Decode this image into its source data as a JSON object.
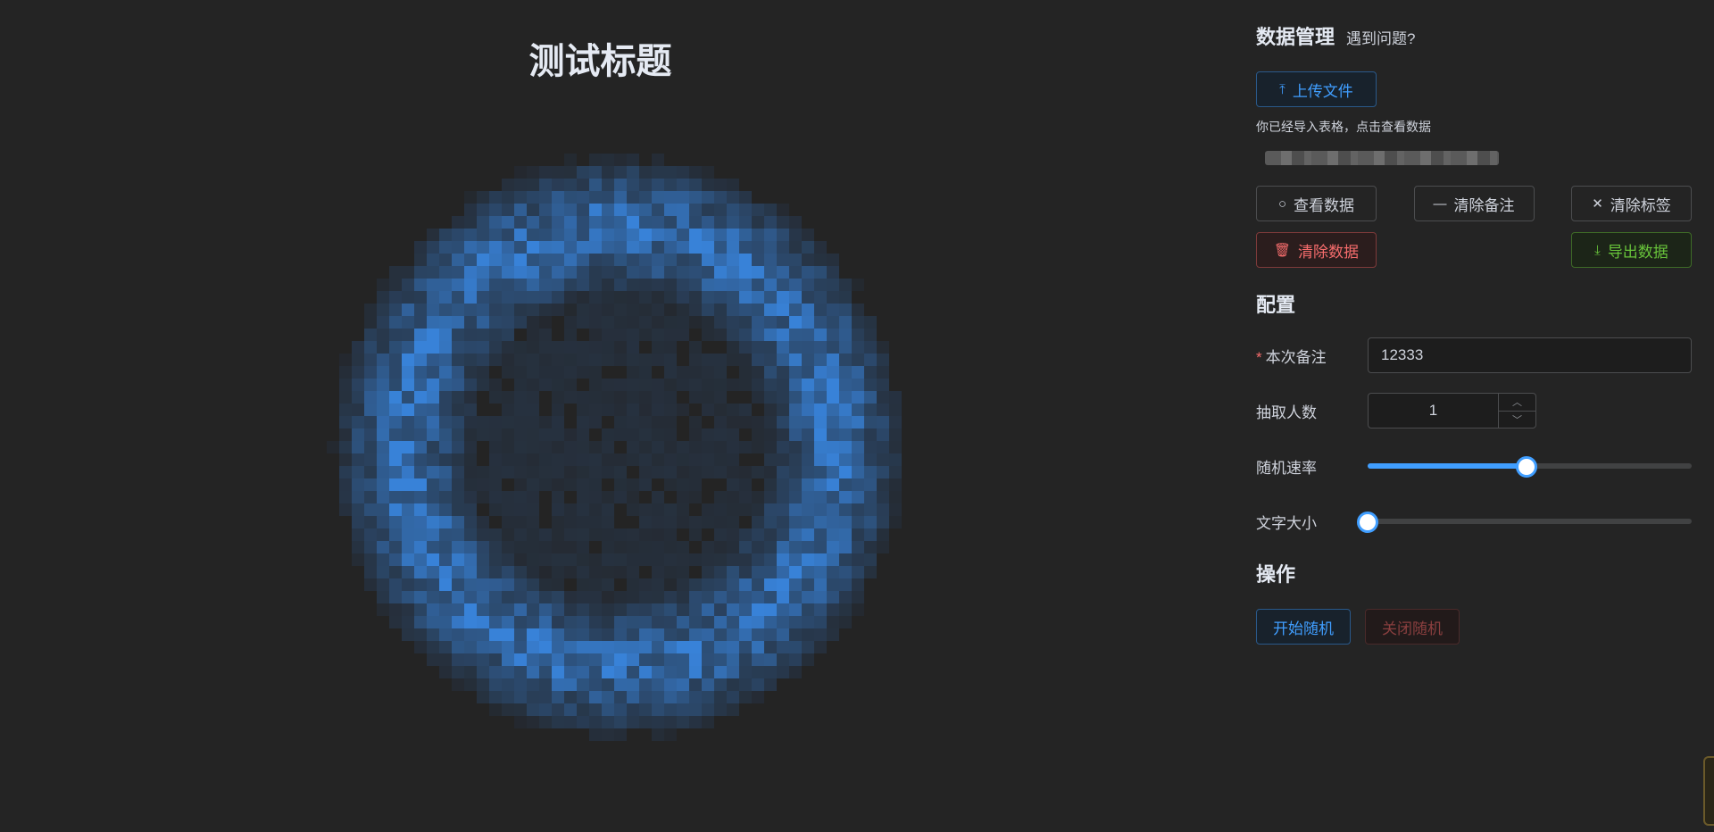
{
  "title": "测试标题",
  "data_section": {
    "heading": "数据管理",
    "help_link": "遇到问题?",
    "upload_label": "上传文件",
    "imported_note": "你已经导入表格，点击查看数据",
    "buttons": {
      "view": "查看数据",
      "clear_notes": "清除备注",
      "clear_tags": "清除标签",
      "clear_data": "清除数据",
      "export": "导出数据"
    }
  },
  "config_section": {
    "heading": "配置",
    "note_label": "本次备注",
    "note_value": "12333",
    "count_label": "抽取人数",
    "count_value": "1",
    "rate_label": "随机速率",
    "rate_fraction": 0.49,
    "font_label": "文字大小",
    "font_fraction": 0.0
  },
  "ops_section": {
    "heading": "操作",
    "start": "开始随机",
    "stop": "关闭随机"
  },
  "colors": {
    "background": "#242424",
    "primary": "#409eff",
    "danger": "#f56c6c",
    "success": "#67c23a"
  },
  "icons": {
    "upload": "upload-icon",
    "search": "search-icon",
    "minus": "minus-icon",
    "close": "close-icon",
    "delete": "trash-icon",
    "download": "download-icon"
  }
}
